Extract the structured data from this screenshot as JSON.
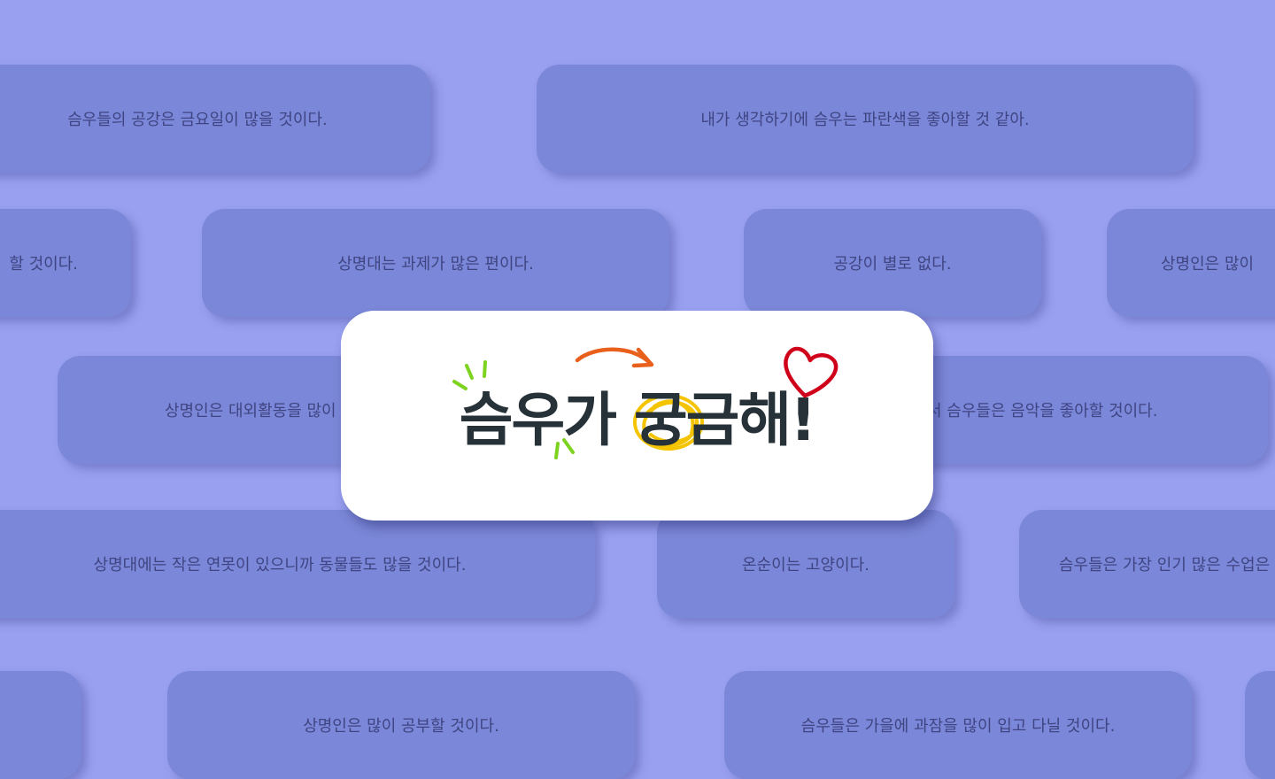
{
  "hero": {
    "title": "슴우가 궁금해!",
    "colors": {
      "arrow": "#e8601c",
      "heart": "#d0021b",
      "sparkle": "#7ed321",
      "scribble": "#f5c400",
      "text": "#263238"
    }
  },
  "cards": [
    "슴우들의 공강은 금요일이 많을 것이다.",
    "내가 생각하기에 슴우는 파란색을 좋아할 것 같아.",
    "할 것이다.",
    "상명대는 과제가 많은 편이다.",
    "공강이 별로 없다.",
    "상명인은 많이",
    "상명인은 대외활동을 많이",
    "서 슴우들은 음악을 좋아할 것이다.",
    "상명대에는 작은 연못이 있으니까 동물들도 많을 것이다.",
    "온순이는 고양이다.",
    "슴우들은 가장 인기 많은 수업은",
    "",
    "상명인은 많이 공부할 것이다.",
    "슴우들은 가을에 과잠을 많이 입고 다닐 것이다.",
    ""
  ],
  "background_color": "#99a0f0",
  "card_color": "#7b87d8"
}
